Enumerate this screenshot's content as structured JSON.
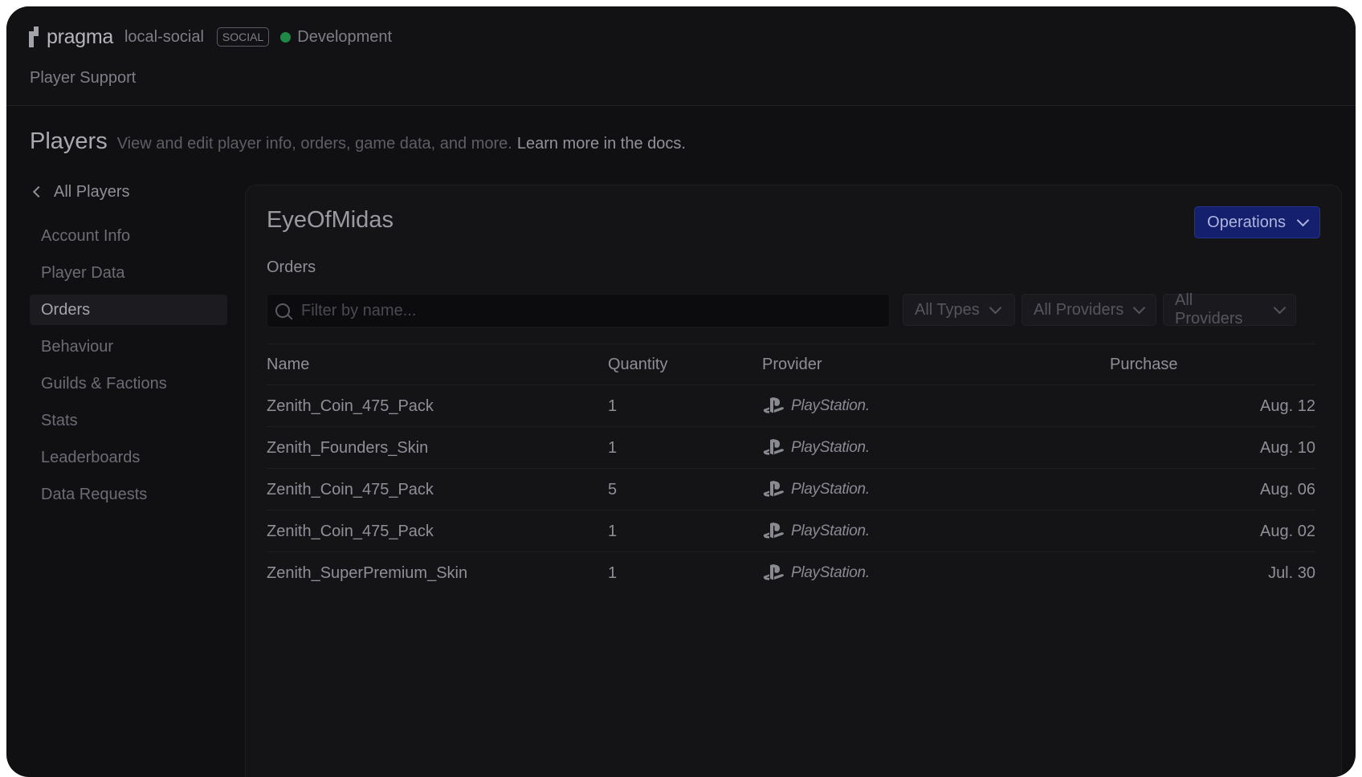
{
  "header": {
    "brand": "pragma",
    "project": "local-social",
    "tag": "SOCIAL",
    "environment": "Development",
    "environment_color": "#1f8a47",
    "nav_title": "Player Support"
  },
  "page": {
    "title": "Players",
    "description": "View and edit player info, orders, game data, and more.",
    "docs_link": "Learn more in the docs."
  },
  "sidebar": {
    "back_label": "All Players",
    "items": [
      {
        "label": "Account Info"
      },
      {
        "label": "Player Data"
      },
      {
        "label": "Orders"
      },
      {
        "label": "Behaviour"
      },
      {
        "label": "Guilds & Factions"
      },
      {
        "label": "Stats"
      },
      {
        "label": "Leaderboards"
      },
      {
        "label": "Data Requests"
      }
    ],
    "active": "Orders"
  },
  "panel": {
    "player_name": "EyeOfMidas",
    "operations_label": "Operations",
    "section_title": "Orders",
    "search": {
      "placeholder": "Filter by name...",
      "value": ""
    },
    "filters": [
      "All Types",
      "All Providers",
      "All Providers"
    ],
    "table": {
      "columns": [
        "Name",
        "Quantity",
        "Provider",
        "Purchase"
      ],
      "rows": [
        {
          "name": "Zenith_Coin_475_Pack",
          "quantity": "1",
          "provider": "PlayStation.",
          "date": "Aug. 12"
        },
        {
          "name": "Zenith_Founders_Skin",
          "quantity": "1",
          "provider": "PlayStation.",
          "date": "Aug. 10"
        },
        {
          "name": "Zenith_Coin_475_Pack",
          "quantity": "5",
          "provider": "PlayStation.",
          "date": "Aug. 06"
        },
        {
          "name": "Zenith_Coin_475_Pack",
          "quantity": "1",
          "provider": "PlayStation.",
          "date": "Aug. 02"
        },
        {
          "name": "Zenith_SuperPremium_Skin",
          "quantity": "1",
          "provider": "PlayStation.",
          "date": "Jul. 30"
        }
      ]
    }
  },
  "colors": {
    "background": "#101012",
    "accent_button": "#14206e"
  },
  "icons": {
    "logo": "pragma-logo-icon",
    "back": "chevron-left-icon",
    "dropdown": "chevron-down-icon",
    "search": "search-icon",
    "provider": "playstation-logo-icon"
  }
}
